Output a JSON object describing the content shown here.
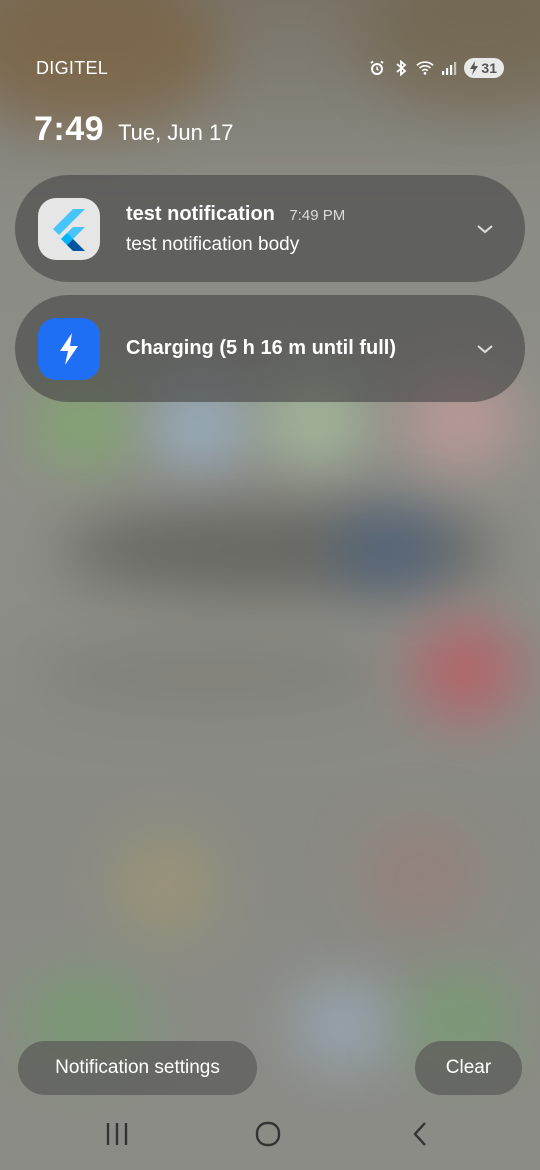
{
  "status_bar": {
    "carrier": "DIGITEL",
    "battery_level": "31",
    "icons": [
      "alarm-icon",
      "bluetooth-icon",
      "wifi-icon",
      "signal-icon",
      "battery-charging-icon"
    ]
  },
  "clock": {
    "time": "7:49",
    "date": "Tue, Jun 17"
  },
  "notifications": [
    {
      "app_icon": "flutter-logo-icon",
      "title": "test notification",
      "time": "7:49 PM",
      "body": "test notification body"
    },
    {
      "app_icon": "lightning-bolt-icon",
      "title": "Charging (5 h 16 m until full)"
    }
  ],
  "actions": {
    "settings_label": "Notification settings",
    "clear_label": "Clear"
  },
  "nav": {
    "icons": [
      "recent-apps-icon",
      "home-icon",
      "back-icon"
    ]
  },
  "colors": {
    "charging_icon_bg": "#1f6ff5",
    "flutter_light": "#47c5fb",
    "flutter_dark": "#00569e"
  }
}
